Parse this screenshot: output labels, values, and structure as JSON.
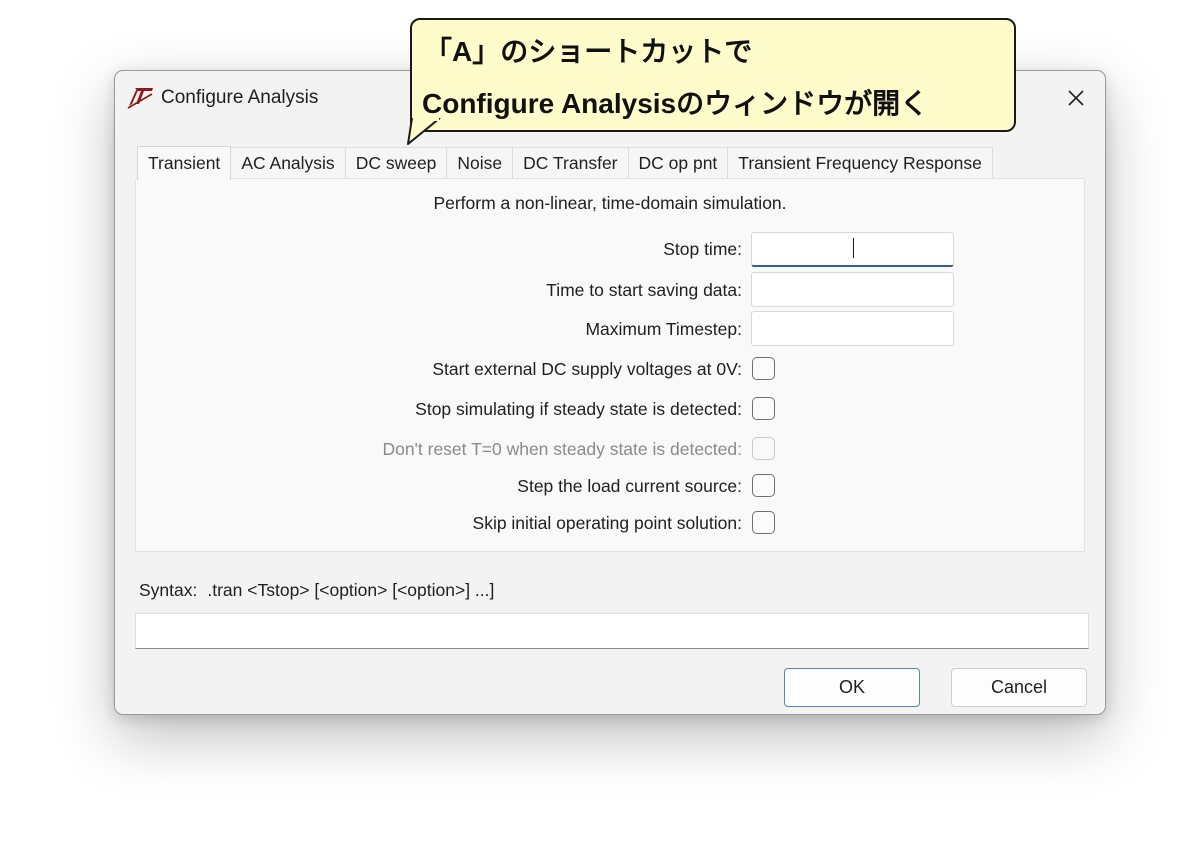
{
  "window": {
    "title": "Configure Analysis",
    "app_icon": "ltspice-logo-icon",
    "close_icon": "close-icon"
  },
  "tabs": [
    {
      "label": "Transient",
      "active": true
    },
    {
      "label": "AC Analysis",
      "active": false
    },
    {
      "label": "DC sweep",
      "active": false
    },
    {
      "label": "Noise",
      "active": false
    },
    {
      "label": "DC Transfer",
      "active": false
    },
    {
      "label": "DC op pnt",
      "active": false
    },
    {
      "label": "Transient Frequency Response",
      "active": false
    }
  ],
  "panel": {
    "description": "Perform a non-linear, time-domain simulation.",
    "fields": [
      {
        "label": "Stop time:",
        "value": "",
        "focused": true
      },
      {
        "label": "Time to start saving data:",
        "value": ""
      },
      {
        "label": "Maximum Timestep:",
        "value": ""
      }
    ],
    "checkboxes": [
      {
        "label": "Start external DC supply voltages at 0V:",
        "checked": false,
        "enabled": true
      },
      {
        "label": "Stop simulating if steady state is detected:",
        "checked": false,
        "enabled": true
      },
      {
        "label": "Don't reset T=0 when steady state is detected:",
        "checked": false,
        "enabled": false
      },
      {
        "label": "Step the load current source:",
        "checked": false,
        "enabled": true
      },
      {
        "label": "Skip initial operating point solution:",
        "checked": false,
        "enabled": true
      }
    ]
  },
  "syntax": {
    "label": "Syntax:",
    "value": ".tran <Tstop> [<option> [<option>] ...]",
    "field_value": ""
  },
  "buttons": {
    "ok": "OK",
    "cancel": "Cancel"
  },
  "callout": {
    "line1": "「A」のショートカットで",
    "line2": "Configure Analysisのウィンドウが開く",
    "background": "#fffccc"
  },
  "colors": {
    "focus_accent": "#2d5f9a",
    "dialog_bg": "#f3f3f3"
  }
}
